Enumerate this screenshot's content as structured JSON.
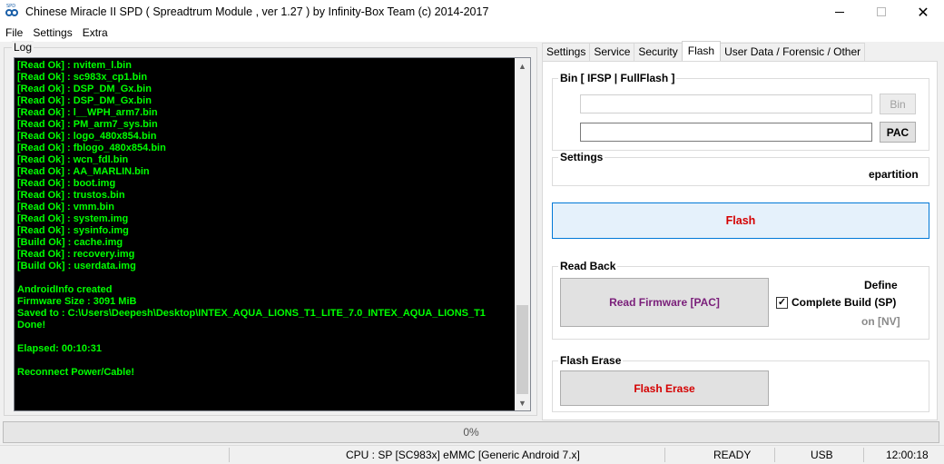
{
  "window": {
    "title": "Chinese Miracle II SPD ( Spreadtrum Module , ver 1.27 ) by Infinity-Box Team (c) 2014-2017",
    "icon_label": "SPD",
    "min_glyph": "",
    "max_glyph": "",
    "close_glyph": "✕"
  },
  "menu": [
    "File",
    "Settings",
    "Extra"
  ],
  "log": {
    "title": "Log",
    "lines": [
      "[Read Ok] : nvitem_l.bin",
      "[Read Ok] : sc983x_cp1.bin",
      "[Read Ok] : DSP_DM_Gx.bin",
      "[Read Ok] : DSP_DM_Gx.bin",
      "[Read Ok] : l__WPH_arm7.bin",
      "[Read Ok] : PM_arm7_sys.bin",
      "[Read Ok] : logo_480x854.bin",
      "[Read Ok] : fblogo_480x854.bin",
      "[Read Ok] : wcn_fdl.bin",
      "[Read Ok] : AA_MARLIN.bin",
      "[Read Ok] : boot.img",
      "[Read Ok] : trustos.bin",
      "[Read Ok] : vmm.bin",
      "[Read Ok] : system.img",
      "[Read Ok] : sysinfo.img",
      "[Build Ok] : cache.img",
      "[Read Ok] : recovery.img",
      "[Build Ok] : userdata.img",
      "",
      "AndroidInfo created",
      "Firmware Size : 3091 MiB",
      "Saved to : C:\\Users\\Deepesh\\Desktop\\INTEX_AQUA_LIONS_T1_LITE_7.0_INTEX_AQUA_LIONS_T1",
      "Done!",
      "",
      "Elapsed: 00:10:31",
      "",
      "Reconnect Power/Cable!"
    ],
    "scroll_up": "▲",
    "scroll_down": "▼"
  },
  "tabs": [
    {
      "label": "Settings",
      "active": false
    },
    {
      "label": "Service",
      "active": false
    },
    {
      "label": "Security",
      "active": false
    },
    {
      "label": "Flash",
      "active": true
    },
    {
      "label": "User Data / Forensic / Other",
      "active": false
    }
  ],
  "flash_panel": {
    "bin_group_title": "Bin  [ IFSP | FullFlash ]",
    "bin_input_value": "",
    "bin_button": "Bin",
    "pac_input_value": "",
    "pac_button": "PAC",
    "settings_group_title": "Settings",
    "settings_partial_text": "epartition",
    "flash_button": "Flash",
    "readback_group_title": "Read Back",
    "read_firmware_button": "Read Firmware [PAC]",
    "define_partial_text": "Define",
    "complete_build_label": "Complete Build (SP)",
    "complete_build_checked": true,
    "nv_partial_text": "on [NV]",
    "flash_erase_group_title": "Flash Erase",
    "flash_erase_button": "Flash Erase"
  },
  "progress": {
    "text": "0%",
    "value": 0
  },
  "statusbar": {
    "cpu": "CPU : SP [SC983x] eMMC [Generic Android 7.x]",
    "state": "READY",
    "port": "USB",
    "time": "12:00:18"
  },
  "colors": {
    "log_text": "#00ff00",
    "log_bg": "#000000",
    "flash_text": "#d40000",
    "read_firmware_text": "#7a1f7a",
    "flash_erase_text": "#d40000",
    "flash_button_border": "#0078d7",
    "flash_button_bg": "#e5f1fb"
  }
}
